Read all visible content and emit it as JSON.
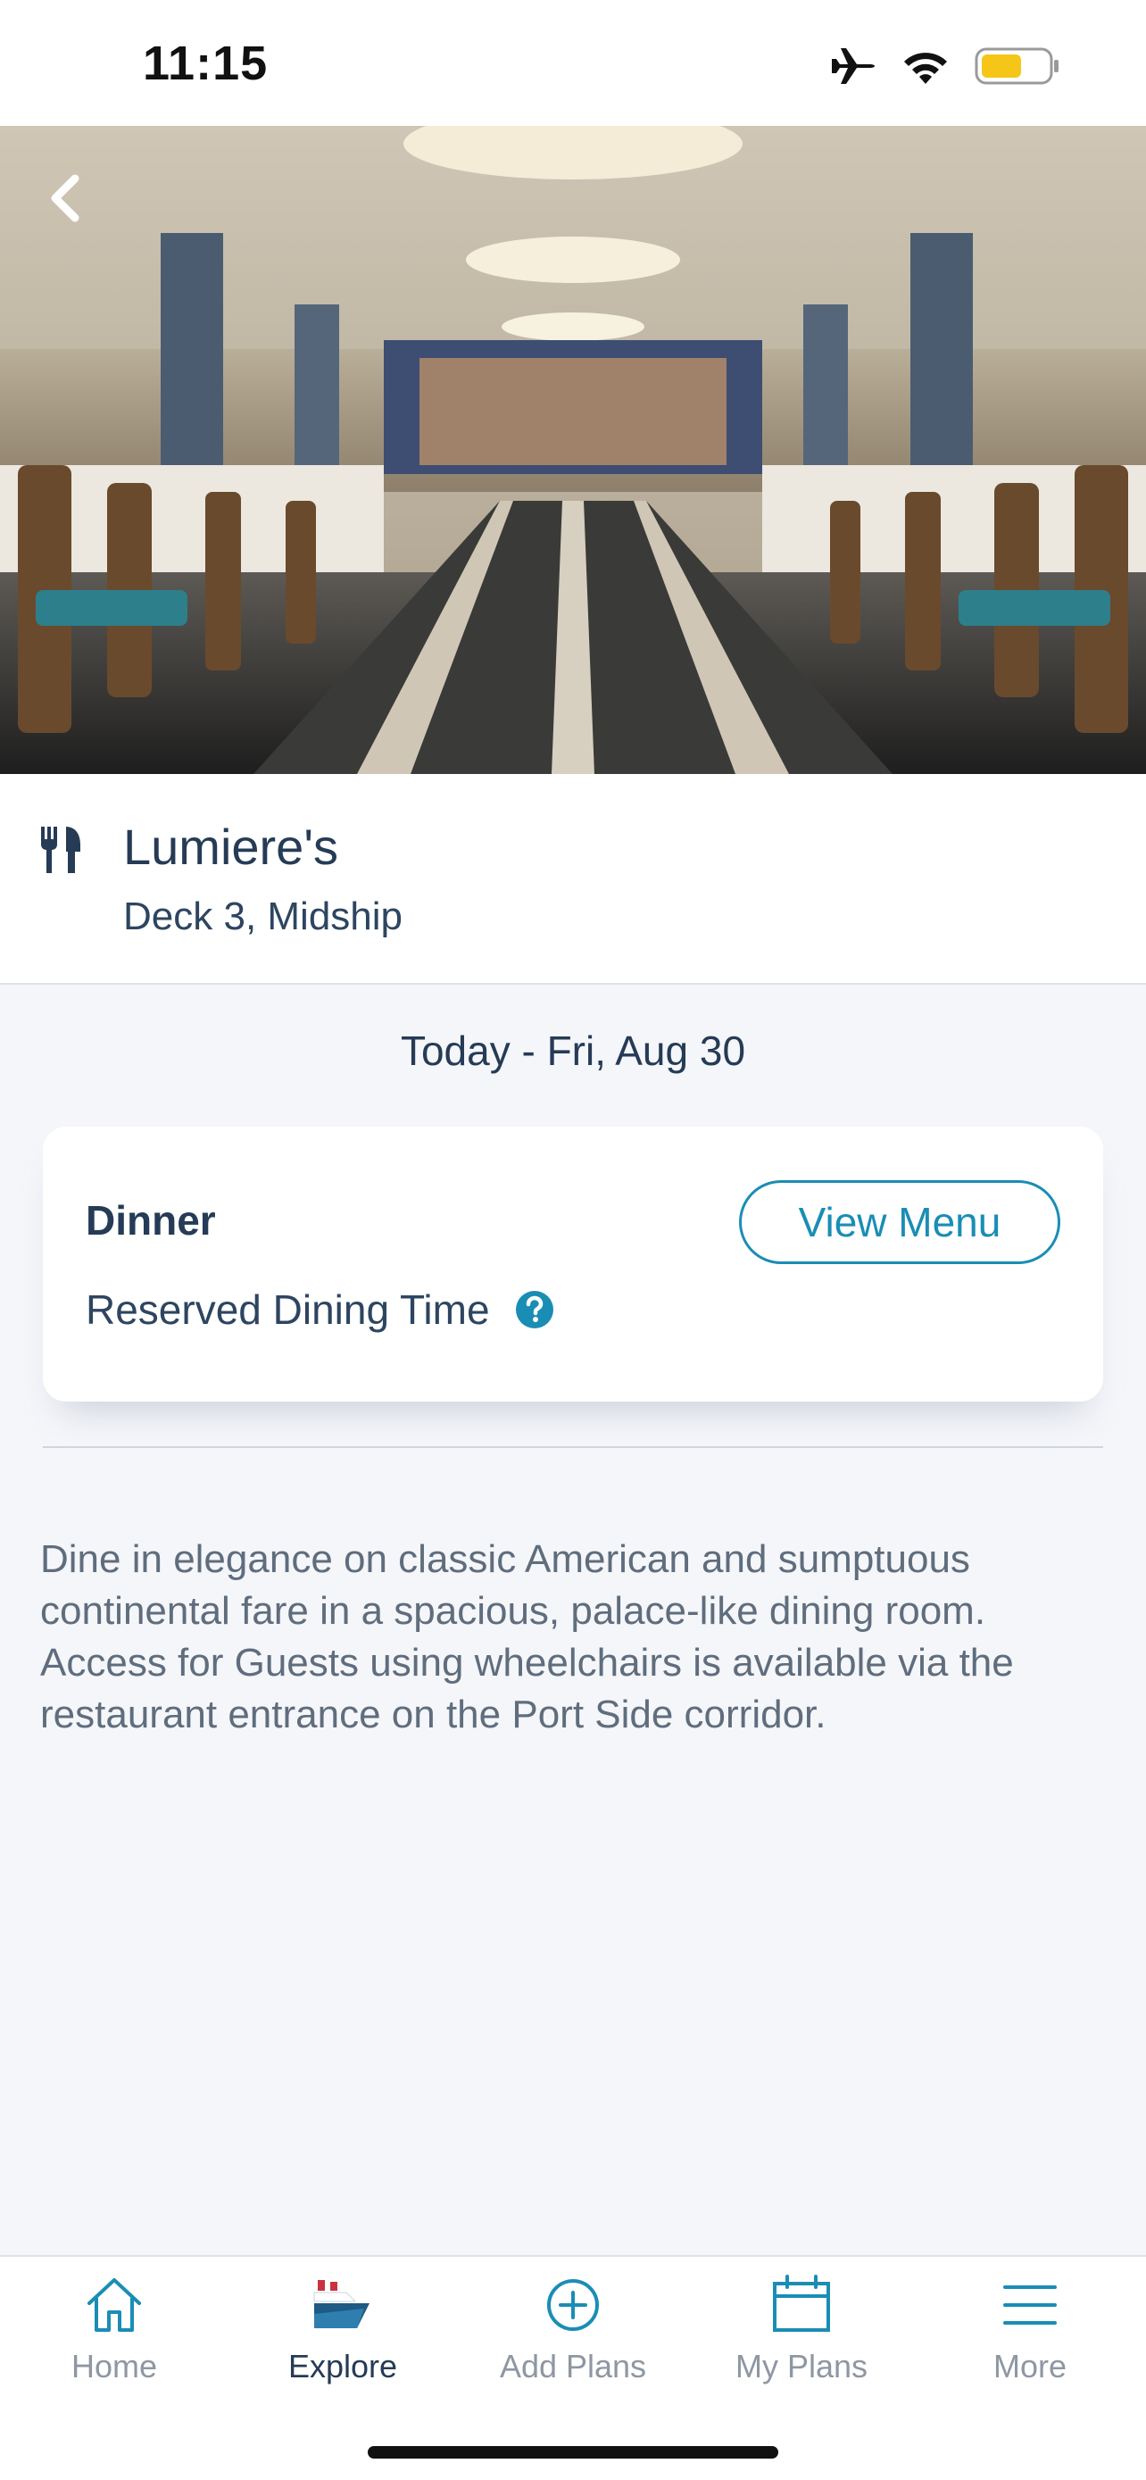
{
  "status_bar": {
    "time": "11:15",
    "icons": [
      "airplane-icon",
      "wifi-icon",
      "battery-icon"
    ],
    "battery_color": "#f5c518"
  },
  "hero": {
    "description_icon": "dining-room-photo",
    "back_icon": "chevron-left-icon"
  },
  "venue": {
    "icon": "utensils-icon",
    "name": "Lumiere's",
    "location": "Deck 3, Midship"
  },
  "date_label": "Today - Fri, Aug 30",
  "meal": {
    "title": "Dinner",
    "view_menu_label": "View Menu",
    "dining_time_label": "Reserved Dining Time",
    "help_icon": "question-circle-icon"
  },
  "description": "Dine in elegance on classic American and sumptuous continental fare in a spacious, palace-like dining room. Access for Guests using wheelchairs is available via the restaurant entrance on the Port Side corridor.",
  "tabs": [
    {
      "label": "Home",
      "icon": "home-icon",
      "active": false
    },
    {
      "label": "Explore",
      "icon": "ship-icon",
      "active": true
    },
    {
      "label": "Add Plans",
      "icon": "plus-circle-icon",
      "active": false
    },
    {
      "label": "My Plans",
      "icon": "calendar-icon",
      "active": false
    },
    {
      "label": "More",
      "icon": "menu-icon",
      "active": false
    }
  ],
  "colors": {
    "accent": "#1a8db5",
    "text_primary": "#253b56",
    "text_muted": "#8e97a3",
    "background": "#f5f6fa"
  }
}
